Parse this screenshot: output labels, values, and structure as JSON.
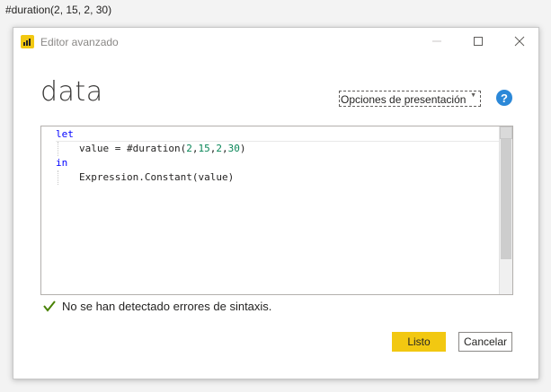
{
  "top_caption": "#duration(2, 15, 2, 30)",
  "window": {
    "title": "Editor avanzado",
    "icon": "power-bi-icon",
    "controls": [
      "minimize-icon",
      "maximize-icon",
      "close-icon"
    ]
  },
  "query_name": "data",
  "display_options_label": "Opciones de presentación",
  "help_label": "?",
  "code": {
    "line1": "let",
    "line2_prefix": "value = #duration(",
    "line2_args": [
      "2",
      "15",
      "2",
      "30"
    ],
    "line2_suffix": ")",
    "line3": "in",
    "line4": "Expression.Constant(value)"
  },
  "status": {
    "icon": "checkmark-icon",
    "text": "No se han detectado errores de sintaxis."
  },
  "buttons": {
    "ok": "Listo",
    "cancel": "Cancelar"
  },
  "colors": {
    "accent": "#f2c811",
    "help": "#2b88d8",
    "keyword": "#0000ff",
    "number": "#098658",
    "check": "#498205"
  }
}
